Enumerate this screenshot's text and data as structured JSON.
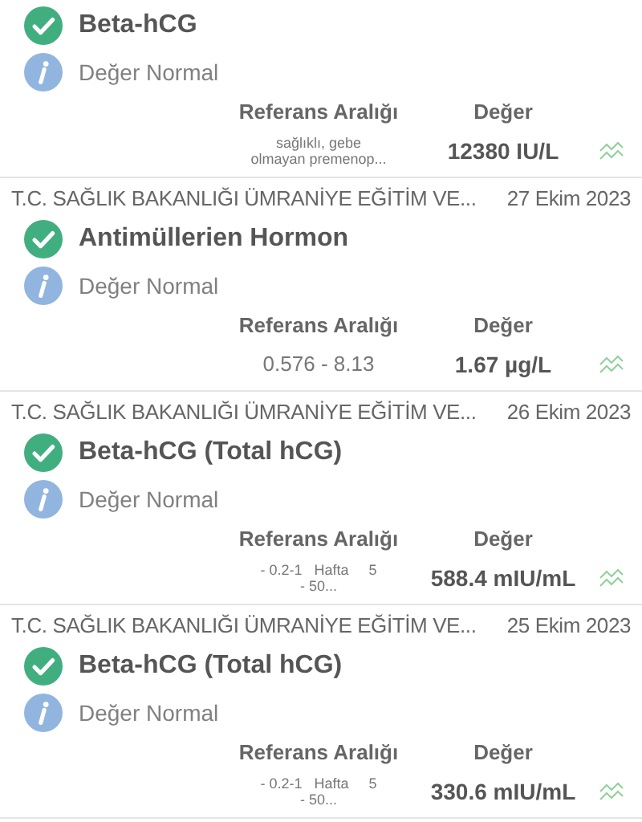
{
  "results": [
    {
      "title": "Beta-hCG",
      "status": "Değer Normal",
      "reference_label": "Referans Aralığı",
      "value_label": "Değer",
      "reference_lines": [
        "sağlıklı, gebe",
        "olmayan premenop..."
      ],
      "value": "12380 IU/L"
    },
    {
      "source": "T.C. SAĞLIK BAKANLIĞI ÜMRANİYE EĞİTİM VE...",
      "date": "27 Ekim 2023",
      "title": "Antimüllerien Hormon",
      "status": "Değer Normal",
      "reference_label": "Referans Aralığı",
      "value_label": "Değer",
      "reference_lines": [
        "0.576 - 8.13"
      ],
      "value": "1.67 µg/L"
    },
    {
      "source": "T.C. SAĞLIK BAKANLIĞI ÜMRANİYE EĞİTİM VE...",
      "date": "26 Ekim 2023",
      "title": "Beta-hCG (Total hCG)",
      "status": "Değer Normal",
      "reference_label": "Referans Aralığı",
      "value_label": "Değer",
      "reference_lines": [
        "- 0.2-1   Hafta     5",
        "- 50..."
      ],
      "value": "588.4 mIU/mL"
    },
    {
      "source": "T.C. SAĞLIK BAKANLIĞI ÜMRANİYE EĞİTİM VE...",
      "date": "25 Ekim 2023",
      "title": "Beta-hCG (Total hCG)",
      "status": "Değer Normal",
      "reference_label": "Referans Aralığı",
      "value_label": "Değer",
      "reference_lines": [
        "- 0.2-1   Hafta     5",
        "- 50..."
      ],
      "value": "330.6 mIU/mL"
    }
  ]
}
